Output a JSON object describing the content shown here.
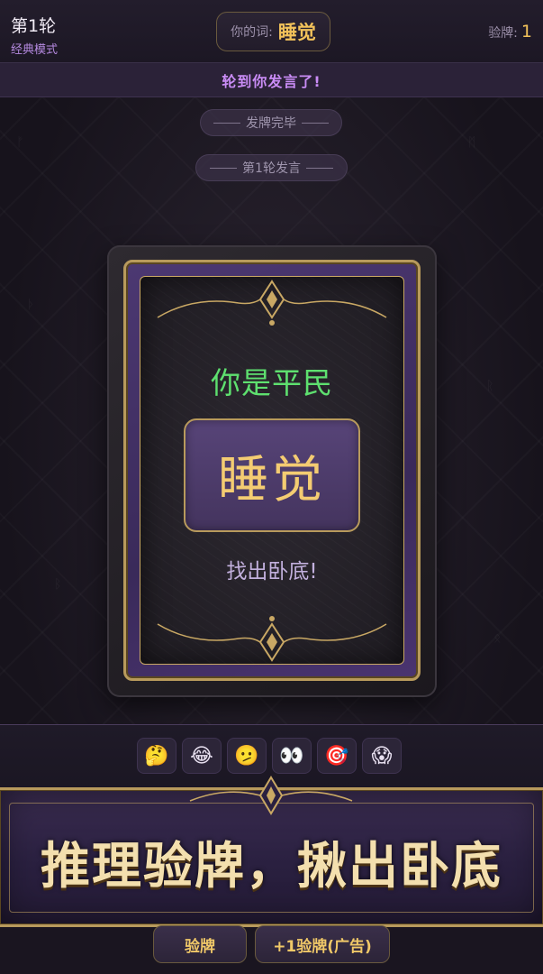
{
  "header": {
    "round_title": "第1轮",
    "mode": "经典模式",
    "word_label": "你的词:",
    "word_value": "睡觉",
    "check_label": "验牌:",
    "check_count": "1"
  },
  "turn_banner": "轮到你发言了!",
  "system_messages": [
    "发牌完毕",
    "第1轮发言"
  ],
  "card": {
    "role": "你是平民",
    "word": "睡觉",
    "mission": "找出卧底!"
  },
  "emojis": [
    "🤔",
    "😂",
    "🫤",
    "👀",
    "🎯",
    "😱"
  ],
  "slogan": "推理验牌，揪出卧底",
  "actions": {
    "check_card": "验牌",
    "add_check_ad": "+1验牌(广告)"
  },
  "colors": {
    "accent_gold": "#f2c25a",
    "role_green": "#5ee06f",
    "banner_purple": "#c98cf5"
  }
}
